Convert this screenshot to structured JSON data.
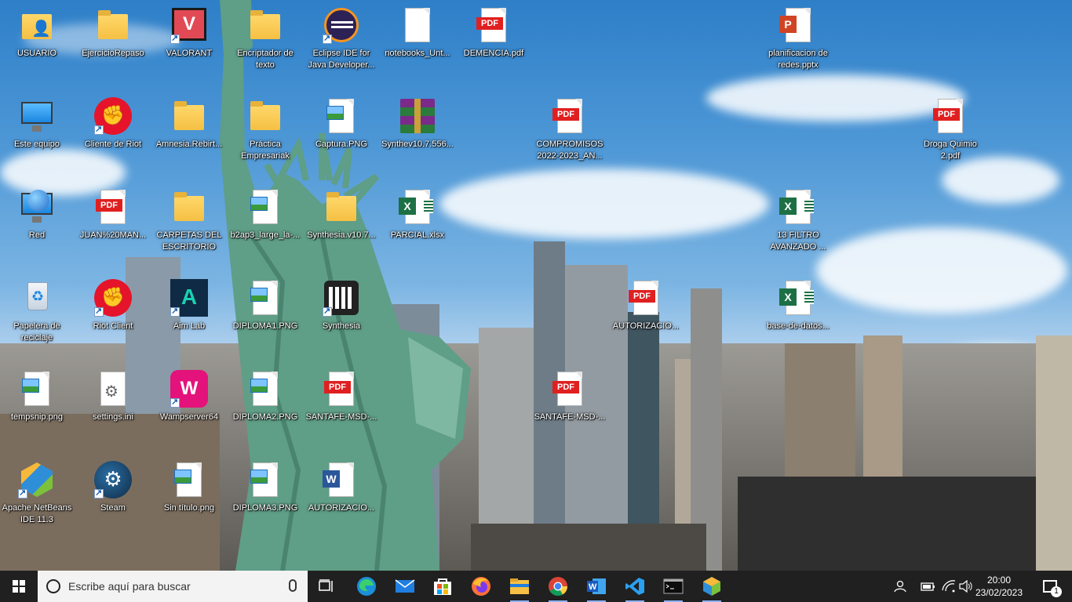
{
  "desktop": {
    "icons": [
      {
        "label": "USUARIO",
        "icon": "user-folder-icon"
      },
      {
        "label": "EjercicioRepaso",
        "icon": "folder-icon"
      },
      {
        "label": "VALORANT",
        "icon": "valorant-icon"
      },
      {
        "label": "Encriptador de texto",
        "icon": "folder-icon"
      },
      {
        "label": "Eclipse IDE for Java Developer...",
        "icon": "eclipse-icon"
      },
      {
        "label": "notebooks_Unt...",
        "icon": "text-file-icon"
      },
      {
        "label": "DEMENCIA.pdf",
        "icon": "pdf-icon"
      },
      {
        "label": "planificacion de redes.pptx",
        "icon": "powerpoint-icon"
      },
      {
        "label": "Este equipo",
        "icon": "computer-icon"
      },
      {
        "label": "Cliente de Riot",
        "icon": "riot-icon"
      },
      {
        "label": "Amnesia.Rebirt...",
        "icon": "folder-icon"
      },
      {
        "label": "Práctica Empresariak",
        "icon": "folder-icon"
      },
      {
        "label": "Captura.PNG",
        "icon": "image-icon"
      },
      {
        "label": "Synthev10.7.556...",
        "icon": "winrar-icon"
      },
      {
        "label": "COMPROMISOS 2022-2023_AN...",
        "icon": "pdf-icon"
      },
      {
        "label": "Droga Quimio 2.pdf",
        "icon": "pdf-icon"
      },
      {
        "label": "Red",
        "icon": "network-icon"
      },
      {
        "label": "JUAN%20MAN...",
        "icon": "pdf-icon"
      },
      {
        "label": "CARPETAS DEL ESCRITORIO",
        "icon": "folder-icon"
      },
      {
        "label": "b2ap3_large_la-...",
        "icon": "image-icon"
      },
      {
        "label": "Synthesia.v10.7...",
        "icon": "folder-icon"
      },
      {
        "label": "PARCIAL.xlsx",
        "icon": "excel-icon"
      },
      {
        "label": "13 FILTRO AVANZADO ...",
        "icon": "excel-icon"
      },
      {
        "label": "Papelera de reciclaje",
        "icon": "recycle-bin-icon"
      },
      {
        "label": "Riot Client",
        "icon": "riot-icon"
      },
      {
        "label": "Aim Lab",
        "icon": "aimlab-icon"
      },
      {
        "label": "DIPLOMA1.PNG",
        "icon": "image-icon"
      },
      {
        "label": "Synthesia",
        "icon": "synthesia-icon"
      },
      {
        "label": "AUTORIZACIO...",
        "icon": "pdf-icon"
      },
      {
        "label": "base-de-datos...",
        "icon": "excel-icon"
      },
      {
        "label": "tempsnip.png",
        "icon": "image-icon"
      },
      {
        "label": "settings.ini",
        "icon": "settings-file-icon"
      },
      {
        "label": "Wampserver64",
        "icon": "wampserver-icon"
      },
      {
        "label": "DIPLOMA2.PNG",
        "icon": "image-icon"
      },
      {
        "label": "SANTAFE-MSD-...",
        "icon": "pdf-icon"
      },
      {
        "label": "SANTAFE-MSD-...",
        "icon": "pdf-icon"
      },
      {
        "label": "Apache NetBeans IDE 11.3",
        "icon": "netbeans-icon"
      },
      {
        "label": "Steam",
        "icon": "steam-icon"
      },
      {
        "label": "Sin título.png",
        "icon": "image-icon"
      },
      {
        "label": "DIPLOMA3.PNG",
        "icon": "image-icon"
      },
      {
        "label": "AUTORIZACIO...",
        "icon": "word-icon"
      }
    ]
  },
  "taskbar": {
    "search_placeholder": "Escribe aquí para buscar",
    "apps": [
      {
        "name": "Vista de tareas",
        "icon": "task-view-icon"
      },
      {
        "name": "Microsoft Edge",
        "icon": "edge-icon"
      },
      {
        "name": "Correo",
        "icon": "mail-icon"
      },
      {
        "name": "Microsoft Store",
        "icon": "store-icon"
      },
      {
        "name": "Firefox",
        "icon": "firefox-icon"
      },
      {
        "name": "Explorador de archivos",
        "icon": "file-explorer-icon"
      },
      {
        "name": "Google Chrome",
        "icon": "chrome-icon"
      },
      {
        "name": "Word",
        "icon": "word-icon"
      },
      {
        "name": "Visual Studio Code",
        "icon": "vscode-icon"
      },
      {
        "name": "Símbolo del sistema",
        "icon": "terminal-icon"
      },
      {
        "name": "NetBeans",
        "icon": "netbeans-icon"
      }
    ],
    "pdf_badge_text": "PDF",
    "clock_time": "20:00",
    "clock_date": "23/02/2023",
    "notification_count": "1"
  }
}
